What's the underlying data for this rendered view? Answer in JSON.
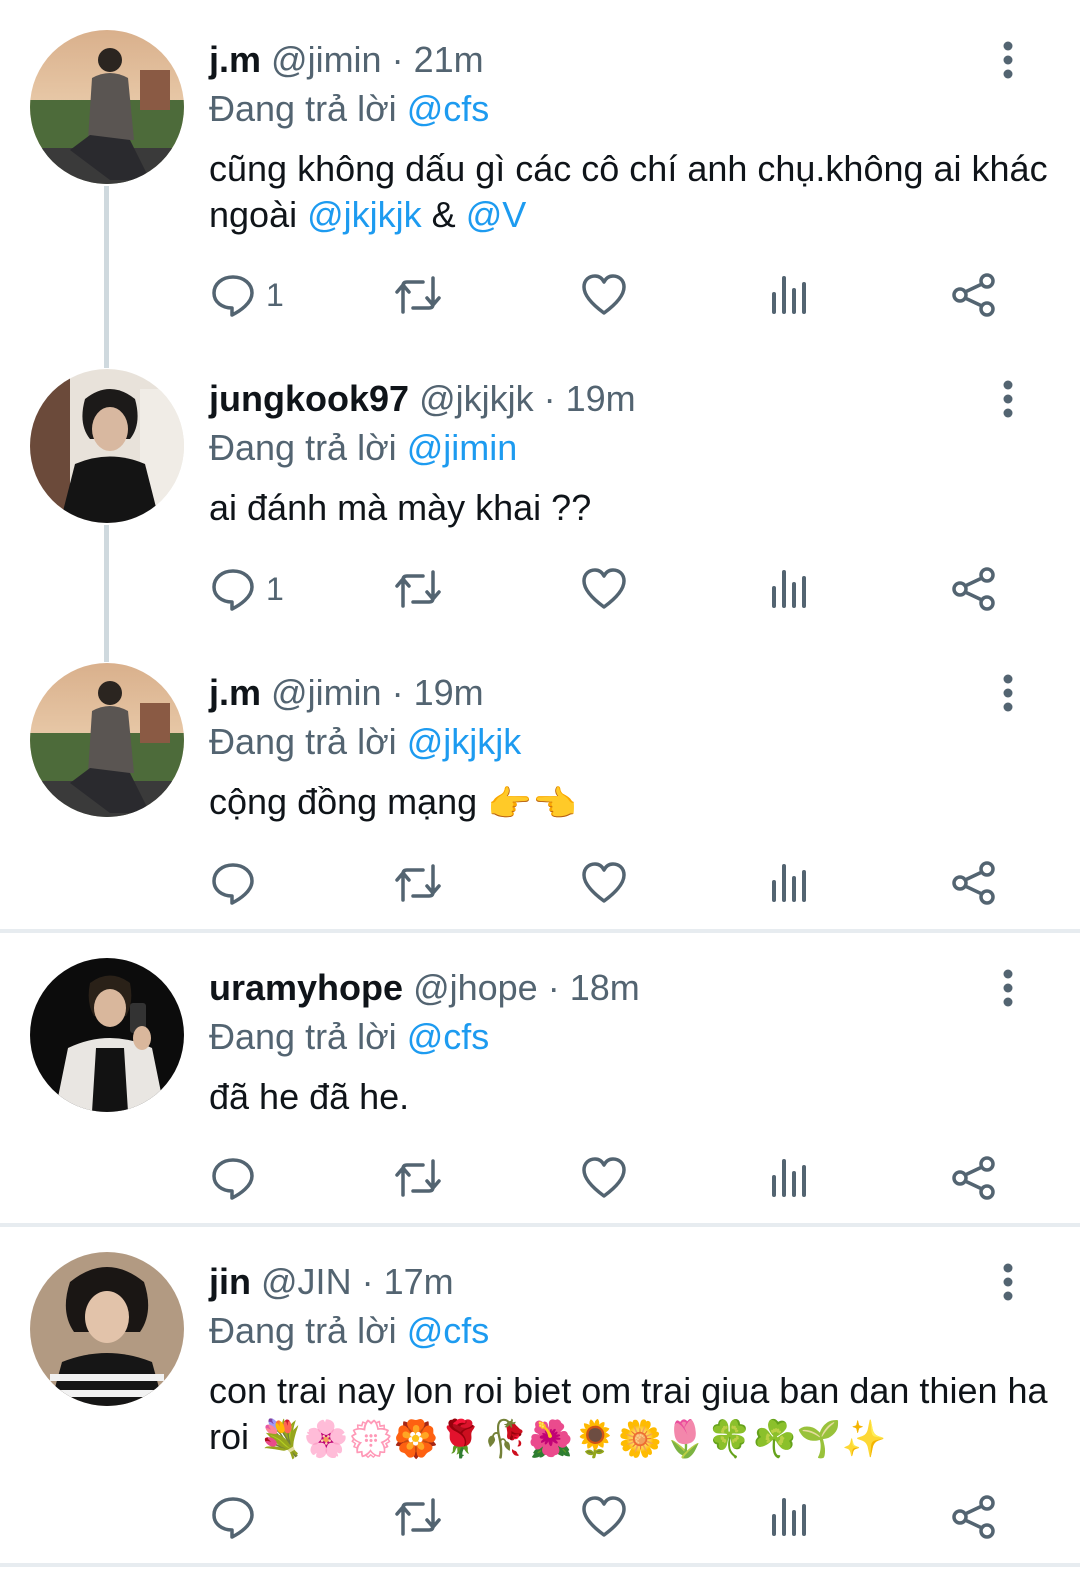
{
  "tweets": [
    {
      "name": "j.m",
      "handle": "@jimin",
      "sep": "·",
      "time": "21m",
      "reply_prefix": "Đang trả lời",
      "reply_to": "@cfs",
      "text_1": "cũng không dấu gì các cô chí anh chụ.không ai khác ngoài",
      "mention_a": "@jkjkjk",
      "amp": "&",
      "mention_b": "@V",
      "reply_count": "1"
    },
    {
      "name": "jungkook97",
      "handle": "@jkjkjk",
      "sep": "·",
      "time": "19m",
      "reply_prefix": "Đang trả lời",
      "reply_to": "@jimin",
      "text": "ai đánh mà mày khai ??",
      "reply_count": "1"
    },
    {
      "name": "j.m",
      "handle": "@jimin",
      "sep": "·",
      "time": "19m",
      "reply_prefix": "Đang trả lời",
      "reply_to": "@jkjkjk",
      "text": "cộng đồng mạng",
      "emoji": "👉👈"
    },
    {
      "name": "uramyhope",
      "handle": "@jhope",
      "sep": "·",
      "time": "18m",
      "reply_prefix": "Đang trả lời",
      "reply_to": "@cfs",
      "text": "đã he đã he."
    },
    {
      "name": "jin",
      "handle": "@JIN",
      "sep": "·",
      "time": "17m",
      "reply_prefix": "Đang trả lời",
      "reply_to": "@cfs",
      "text": "con trai nay lon roi biet om trai giua ban dan thien ha roi",
      "emoji": "💐🌸💮🏵️🌹🥀🌺🌻🌼🌷🍀☘️🌱✨"
    }
  ],
  "icons": {
    "reply": "speech-bubble-icon",
    "retweet": "retweet-icon",
    "like": "heart-icon",
    "views": "bar-chart-icon",
    "share": "share-icon",
    "more": "vertical-dots-icon"
  },
  "colors": {
    "mention": "#1d9bf0",
    "secondary": "#536471",
    "icon": "#536471",
    "thread_line": "#cfd9de"
  }
}
